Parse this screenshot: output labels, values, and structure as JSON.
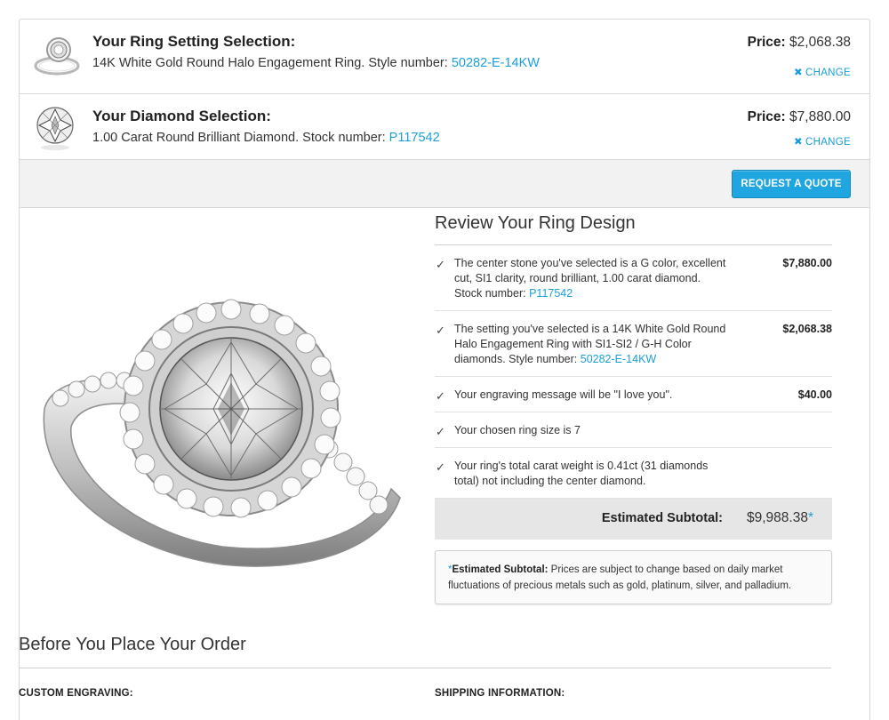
{
  "setting": {
    "title": "Your Ring Setting Selection:",
    "desc_prefix": "14K White Gold Round Halo Engagement Ring. Style number: ",
    "style_number": "50282-E-14KW",
    "price_label": "Price:",
    "price_value": "$2,068.38",
    "change_label": "CHANGE",
    "thumb_icon": "ring-setting-thumbnail"
  },
  "diamond": {
    "title": "Your Diamond Selection:",
    "desc_prefix": "1.00 Carat Round Brilliant Diamond. Stock number: ",
    "stock_number": "P117542",
    "price_label": "Price:",
    "price_value": "$7,880.00",
    "change_label": "CHANGE",
    "thumb_icon": "diamond-thumbnail"
  },
  "quote_button": "REQUEST A QUOTE",
  "review": {
    "title": "Review Your Ring Design",
    "items": [
      {
        "text": "The center stone you've selected is a G color, excellent cut, SI1 clarity, round brilliant, 1.00 carat diamond. Stock number: ",
        "link": "P117542",
        "amount": "$7,880.00"
      },
      {
        "text": "The setting you've selected is a 14K White Gold Round Halo Engagement Ring with SI1-SI2 / G-H Color diamonds. Style number: ",
        "link": "50282-E-14KW",
        "amount": "$2,068.38"
      },
      {
        "text": "Your engraving message will be \"I love you\".",
        "link": "",
        "amount": "$40.00"
      },
      {
        "text": "Your chosen ring size is 7",
        "link": "",
        "amount": ""
      },
      {
        "text": "Your ring's total carat weight is 0.41ct (31 diamonds total) not including the center diamond.",
        "link": "",
        "amount": ""
      }
    ],
    "subtotal_label": "Estimated Subtotal:",
    "subtotal_value": "$9,988.38",
    "subtotal_star": "*",
    "note_star": "*",
    "note_bold": "Estimated Subtotal:",
    "note_text": " Prices are subject to change based on daily market fluctuations of precious metals such as gold, platinum, silver, and palladium."
  },
  "before": {
    "title": "Before You Place Your Order",
    "col1": "CUSTOM ENGRAVING:",
    "col2": "SHIPPING INFORMATION:"
  },
  "colors": {
    "link": "#1a9ed9",
    "button": "#1fa6e0",
    "subtotal_bg": "#e6e6e6",
    "bar_bg": "#f2f2f2"
  }
}
